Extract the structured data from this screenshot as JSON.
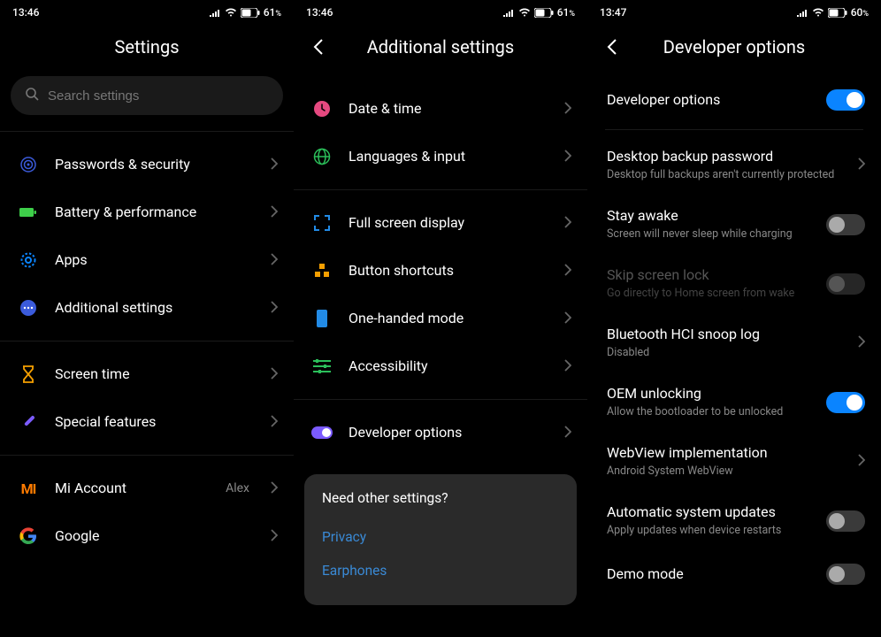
{
  "panels": {
    "settings": {
      "time": "13:46",
      "battery": "61",
      "title": "Settings",
      "search_placeholder": "Search settings",
      "groups": [
        [
          {
            "icon": "target",
            "color": "#3b5bdb",
            "label": "Passwords & security"
          },
          {
            "icon": "battery-block",
            "color": "#3ecf4a",
            "label": "Battery & performance"
          },
          {
            "icon": "gear",
            "color": "#0a84ff",
            "label": "Apps"
          },
          {
            "icon": "dots",
            "color": "#3b5bdb",
            "label": "Additional settings"
          }
        ],
        [
          {
            "icon": "hourglass",
            "color": "#f59f00",
            "label": "Screen time"
          },
          {
            "icon": "wand",
            "color": "#7b5bff",
            "label": "Special features"
          }
        ],
        [
          {
            "icon": "mi",
            "color": "#ff7b00",
            "label": "Mi Account",
            "value": "Alex"
          },
          {
            "icon": "google",
            "color": "",
            "label": "Google"
          }
        ]
      ]
    },
    "additional": {
      "time": "13:46",
      "battery": "61",
      "title": "Additional settings",
      "groups": [
        [
          {
            "icon": "clock",
            "color": "#e64980",
            "label": "Date & time"
          },
          {
            "icon": "globe",
            "color": "#2bbf5a",
            "label": "Languages & input"
          }
        ],
        [
          {
            "icon": "fullscreen",
            "color": "#228be6",
            "label": "Full screen display"
          },
          {
            "icon": "shortcuts",
            "color": "#f59f00",
            "label": "Button shortcuts"
          },
          {
            "icon": "phone",
            "color": "#228be6",
            "label": "One-handed mode"
          },
          {
            "icon": "accessibility",
            "color": "#2bbf5a",
            "label": "Accessibility"
          }
        ],
        [
          {
            "icon": "toggle",
            "color": "#7b5bff",
            "label": "Developer options"
          }
        ]
      ],
      "footer": {
        "title": "Need other settings?",
        "links": [
          "Privacy",
          "Earphones"
        ]
      }
    },
    "developer": {
      "time": "13:47",
      "battery": "60",
      "title": "Developer options",
      "items": [
        {
          "label": "Developer options",
          "type": "toggle",
          "on": true,
          "divider_after": true
        },
        {
          "label": "Desktop backup password",
          "sub": "Desktop full backups aren't currently protected",
          "type": "chevron"
        },
        {
          "label": "Stay awake",
          "sub": "Screen will never sleep while charging",
          "type": "toggle",
          "on": false
        },
        {
          "label": "Skip screen lock",
          "sub": "Go directly to Home screen from wake",
          "type": "toggle",
          "on": false,
          "disabled": true
        },
        {
          "label": "Bluetooth HCI snoop log",
          "sub": "Disabled",
          "type": "chevron"
        },
        {
          "label": "OEM unlocking",
          "sub": "Allow the bootloader to be unlocked",
          "type": "toggle",
          "on": true
        },
        {
          "label": "WebView implementation",
          "sub": "Android System WebView",
          "type": "chevron"
        },
        {
          "label": "Automatic system updates",
          "sub": "Apply updates when device restarts",
          "type": "toggle",
          "on": false
        },
        {
          "label": "Demo mode",
          "type": "toggle",
          "on": false
        }
      ]
    }
  }
}
